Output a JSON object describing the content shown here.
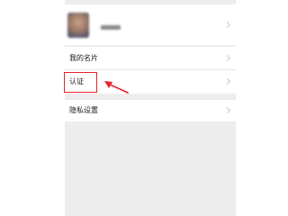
{
  "settings": {
    "items": [
      {
        "label": "我的名片"
      },
      {
        "label": "认证"
      },
      {
        "label": "隐私设置"
      }
    ]
  },
  "annotation": {
    "highlight_color": "#e8232a"
  },
  "colors": {
    "background": "#ededed",
    "row": "#ffffff",
    "text": "#1a1a1a",
    "chevron": "#c7c7c7"
  }
}
